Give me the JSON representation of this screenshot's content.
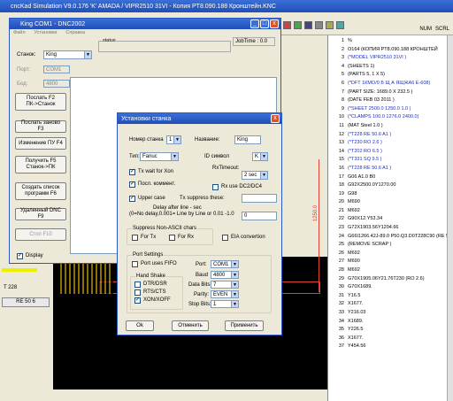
{
  "main_title": "cncKad Simulation V9.0.176  'K'  AMADA / VIPR2510  31VI   -  Копия PT8.090.188 Кронштейн.KNC",
  "ruler_box": {
    "label": "NUM",
    "label2": "SCRL"
  },
  "left_status": {
    "t_label": "T 228",
    "re_label": "RE 50 6"
  },
  "dnc_window": {
    "title": "King COM1  -  DNC2002",
    "menu": [
      "Файл",
      "Установки",
      "Справка"
    ],
    "status_label": "status",
    "jobtime_label": "JobTime : 0.0",
    "fields": {
      "machine_label": "Станок:",
      "machine_value": "King",
      "port_label": "Порт:",
      "port_value": "COM1",
      "baud_label": "Бод:",
      "baud_value": "4800"
    },
    "buttons": [
      "Послать F2\nПК->Станок",
      "Послать заново F3",
      "Изменение ПУ  F4",
      "Получить F5\nСтанок->ПК",
      "Создать список\nпрограмм F6",
      "Удаленный DNC  F9",
      "Стоп F10"
    ],
    "display_label": "Display",
    "display_checked": true
  },
  "settings_dialog": {
    "title": "Установки станка",
    "machine_number_label": "Номер станка",
    "machine_number_value": "1",
    "name_label": "Название:",
    "name_value": "King",
    "type_label": "Тип:",
    "type_value": "Fanuc",
    "id_label": "ID символ",
    "id_value": "K",
    "tx_wait": {
      "label": "Tx wait for Xon",
      "checked": true
    },
    "rx_timeout_label": "RxTimeout:",
    "rx_timeout_value": "2 sec",
    "send_comment": {
      "label": "Посл. коммент.",
      "checked": true
    },
    "rx_use_dc": {
      "label": "Rx use DC2/DC4",
      "checked": false
    },
    "upper_case": {
      "label": "Upper case",
      "checked": true
    },
    "tx_suppress_label": "Tx suppress these:",
    "tx_suppress_value": "",
    "delay_label": "Delay after line - sec",
    "delay_label2": "(0=No delay,0.001= Line by Line or 0.01 -1.0",
    "delay_value": "0",
    "suppress_group": "Suppress Non-ASCII chars",
    "for_tx": {
      "label": "For Tx",
      "checked": false
    },
    "for_rx": {
      "label": "For Rx",
      "checked": false
    },
    "eia": {
      "label": "EIA convertion",
      "checked": false
    },
    "port_group": "Port Settings",
    "port_uses_fifo": {
      "label": "Port uses FIFO",
      "checked": false
    },
    "handshake_group": "Hand Shake",
    "dtr_dsr": {
      "label": "DTR/DSR",
      "checked": false
    },
    "rts_cts": {
      "label": "RTS/CTS",
      "checked": false
    },
    "xon_xoff": {
      "label": "XON/XOFF",
      "checked": true
    },
    "port_label": "Port:",
    "port_value": "COM1",
    "baud_label": "Baud",
    "baud_value": "4800",
    "data_bits_label": "Data Bits:",
    "data_bits_value": "7",
    "parity_label": "Parity:",
    "parity_value": "EVEN",
    "stop_bits_label": "Stop Bits:",
    "stop_bits_value": "1",
    "ok_label": "Ok",
    "cancel_label": "Отменить",
    "apply_label": "Применить"
  },
  "drawing": {
    "dim_label": "1250.0"
  },
  "code_lines": [
    {
      "num": "1",
      "text": "%",
      "color": "black"
    },
    {
      "num": "2",
      "text": "O164 (КОПИЯ PT8.090.188 КРОНШТЕЙ",
      "color": "black"
    },
    {
      "num": "3",
      "text": "(*MODEL VIPR2510 31VI )",
      "color": "blue"
    },
    {
      "num": "4",
      "text": "(SHEETS 1)",
      "color": "black"
    },
    {
      "num": "5",
      "text": "(PARTS 5, 1 X 5)",
      "color": "black"
    },
    {
      "num": "6",
      "text": "(*DFT 1КМО/0  Б  Щ  А  ЯЩЖА6 E-608)",
      "color": "blue"
    },
    {
      "num": "7",
      "text": "(PART SIZE: 1689.0 X 232.5 )",
      "color": "black"
    },
    {
      "num": "8",
      "text": "(DATE FEB 03 2011 )",
      "color": "black"
    },
    {
      "num": "9",
      "text": "(*SHEET 2500.0 1250.0 1.0 )",
      "color": "blue"
    },
    {
      "num": "10",
      "text": "(*CLAMPS 100.0 1276.0 2400.0)",
      "color": "blue"
    },
    {
      "num": "11",
      "text": "(MAT Steel 1.0 )",
      "color": "black"
    },
    {
      "num": "12",
      "text": "(*T228  RE 50.6  A1 )",
      "color": "blue"
    },
    {
      "num": "13",
      "text": "(*T230  RO 2.6 )",
      "color": "blue"
    },
    {
      "num": "14",
      "text": "(*T202  RO 6.5 )",
      "color": "blue"
    },
    {
      "num": "15",
      "text": "(*T331  SQ 9.5 )",
      "color": "blue"
    },
    {
      "num": "16",
      "text": "(*T228  RE 50.6  A1 )",
      "color": "blue"
    },
    {
      "num": "17",
      "text": "G06 A1.0 B0",
      "color": "black"
    },
    {
      "num": "18",
      "text": "G92X2500.0Y1270.00",
      "color": "black"
    },
    {
      "num": "19",
      "text": "G98",
      "color": "black"
    },
    {
      "num": "20",
      "text": "M690",
      "color": "black"
    },
    {
      "num": "21",
      "text": "M692",
      "color": "black"
    },
    {
      "num": "22",
      "text": "G90X12.Y53.34",
      "color": "black"
    },
    {
      "num": "23",
      "text": "G72X1903.56Y1204.66",
      "color": "black"
    },
    {
      "num": "24",
      "text": "G66I1266.42J-89.0 P50.Q3.D0T228C90 (RE 5",
      "color": "black"
    },
    {
      "num": "25",
      "text": "(REMOVE SCRAP )",
      "color": "black"
    },
    {
      "num": "26",
      "text": "M692",
      "color": "black"
    },
    {
      "num": "27",
      "text": "M690",
      "color": "black"
    },
    {
      "num": "28",
      "text": "M692",
      "color": "black"
    },
    {
      "num": "29",
      "text": "G70X1905.06Y21.76T230 (RO 2.6)",
      "color": "black"
    },
    {
      "num": "30",
      "text": "G70X1689.",
      "color": "black"
    },
    {
      "num": "31",
      "text": "Y16.5",
      "color": "black"
    },
    {
      "num": "32",
      "text": "X1677.",
      "color": "black"
    },
    {
      "num": "33",
      "text": "Y216.03",
      "color": "black"
    },
    {
      "num": "34",
      "text": "X1689.",
      "color": "black"
    },
    {
      "num": "35",
      "text": "Y226.5",
      "color": "black"
    },
    {
      "num": "36",
      "text": "X1677.",
      "color": "black"
    },
    {
      "num": "37",
      "text": "Y454.56",
      "color": "black"
    }
  ]
}
